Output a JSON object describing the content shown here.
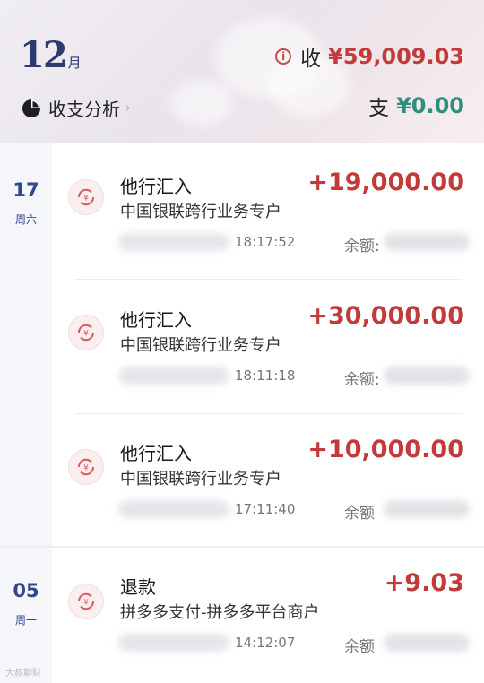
{
  "header": {
    "month_number": "12",
    "month_unit": "月",
    "analysis_label": "收支分析",
    "income_label": "收",
    "income_value": "¥59,009.03",
    "expense_label": "支",
    "expense_value": "¥0.00"
  },
  "sections": [
    {
      "day": "17",
      "weekday": "周六"
    },
    {
      "day": "05",
      "weekday": "周一"
    }
  ],
  "transactions": [
    {
      "title": "他行汇入",
      "subtitle": "中国银联跨行业务专户",
      "amount": "+19,000.00",
      "time": "18:17:52",
      "balance_label": "余额:"
    },
    {
      "title": "他行汇入",
      "subtitle": "中国银联跨行业务专户",
      "amount": "+30,000.00",
      "time": "18:11:18",
      "balance_label": "余额:"
    },
    {
      "title": "他行汇入",
      "subtitle": "中国银联跨行业务专户",
      "amount": "+10,000.00",
      "time": "17:11:40",
      "balance_label": "余额"
    },
    {
      "title": "退款",
      "subtitle": "拼多多支付-拼多多平台商户",
      "amount": "+9.03",
      "time": "14:12:07",
      "balance_label": "余额"
    }
  ],
  "watermark": "大叔聊财"
}
